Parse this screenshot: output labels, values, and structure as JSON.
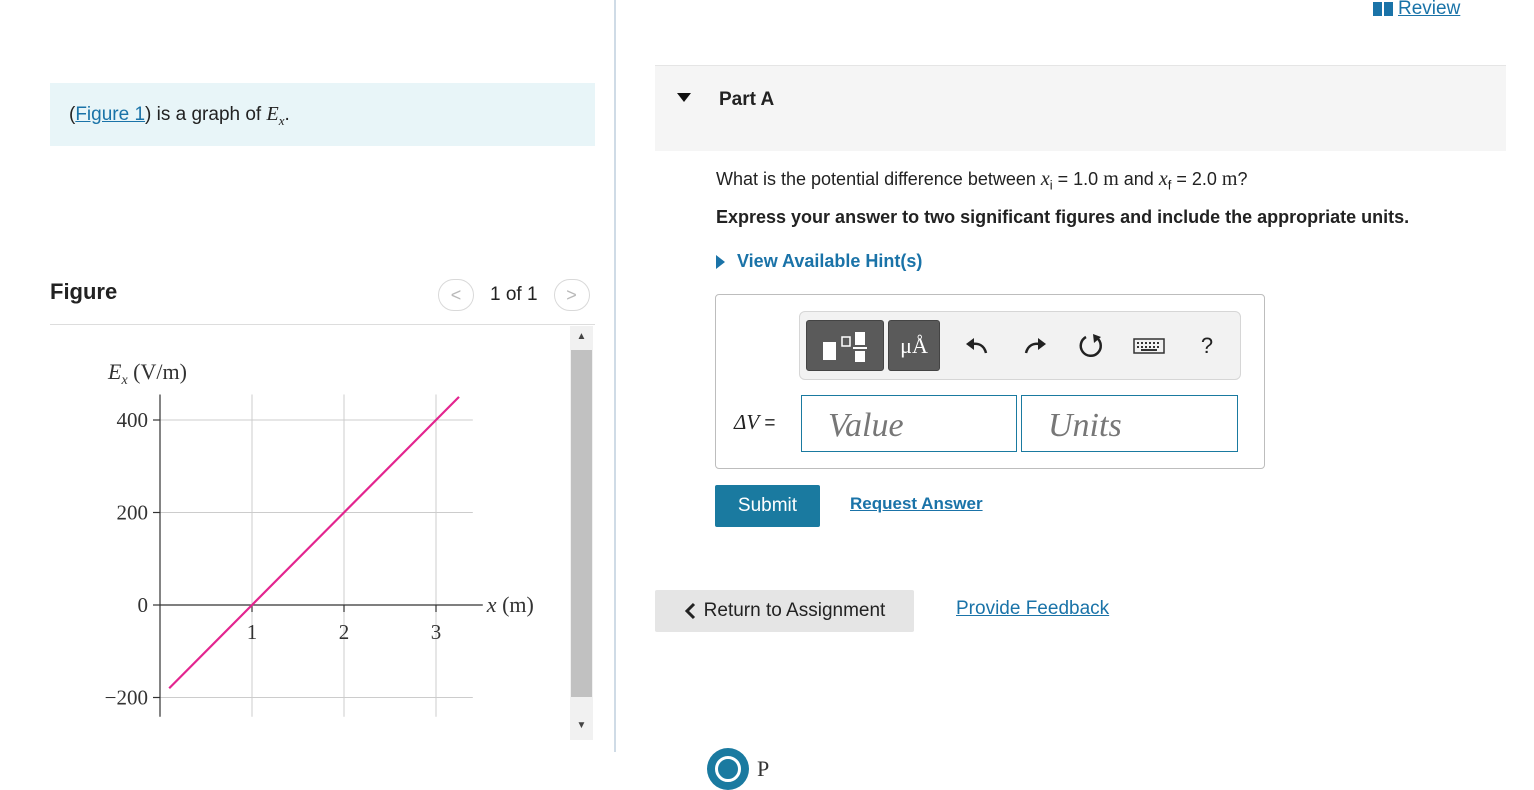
{
  "intro": {
    "open": "(",
    "link": "Figure 1",
    "rest": ") is a graph of ",
    "var": "E",
    "var_sub": "x",
    "end": "."
  },
  "figure": {
    "title": "Figure",
    "counter": "1 of 1",
    "prev_glyph": "<",
    "next_glyph": ">"
  },
  "chart_data": {
    "type": "line",
    "ylabel": "E",
    "ylabel_sub": "x",
    "ylabel_unit": "(V/m)",
    "xlabel": "x (m)",
    "xlabel_var": "x",
    "xlabel_unit": "(m)",
    "x_ticks": [
      "1",
      "2",
      "3"
    ],
    "y_ticks": [
      "400",
      "200",
      "0",
      "−200"
    ],
    "xlim": [
      0,
      3.4
    ],
    "ylim": [
      -200,
      400
    ],
    "grid": true,
    "line_color": "#e3258f",
    "series": [
      {
        "x": [
          0.1,
          1,
          2,
          3,
          3.25
        ],
        "y": [
          -180,
          0,
          200,
          400,
          450
        ]
      }
    ]
  },
  "review": {
    "label": "Review"
  },
  "part": {
    "title": "Part A"
  },
  "question": {
    "prefix": "What is the potential difference between ",
    "xi_var": "x",
    "xi_sub": "i",
    "xi_eq": " = 1.0 ",
    "xi_unit": "m",
    "and": " and ",
    "xf_var": "x",
    "xf_sub": "f",
    "xf_eq": " = 2.0 ",
    "xf_unit": "m",
    "suffix": "?"
  },
  "instruction": "Express your answer to two significant figures and include the appropriate units.",
  "hints": {
    "label": "View Available Hint(s)"
  },
  "toolbar": {
    "units_label": "μÅ",
    "help_label": "?",
    "icons": [
      "templates-icon",
      "units-icon",
      "undo-icon",
      "redo-icon",
      "reset-icon",
      "keyboard-icon",
      "help-icon"
    ]
  },
  "answer": {
    "lhs_delta": "Δ",
    "lhs_var": "V",
    "lhs_eq": " =",
    "value_placeholder": "Value",
    "units_placeholder": "Units"
  },
  "buttons": {
    "submit": "Submit",
    "request_answer": "Request Answer",
    "return": "Return to Assignment",
    "feedback": "Provide Feedback"
  },
  "footer": {
    "brand_glyph": "P"
  },
  "colors": {
    "accent": "#1a7aa0",
    "link": "#1a73a8",
    "plot_line": "#e3258f",
    "intro_bg": "#e8f5f8"
  }
}
